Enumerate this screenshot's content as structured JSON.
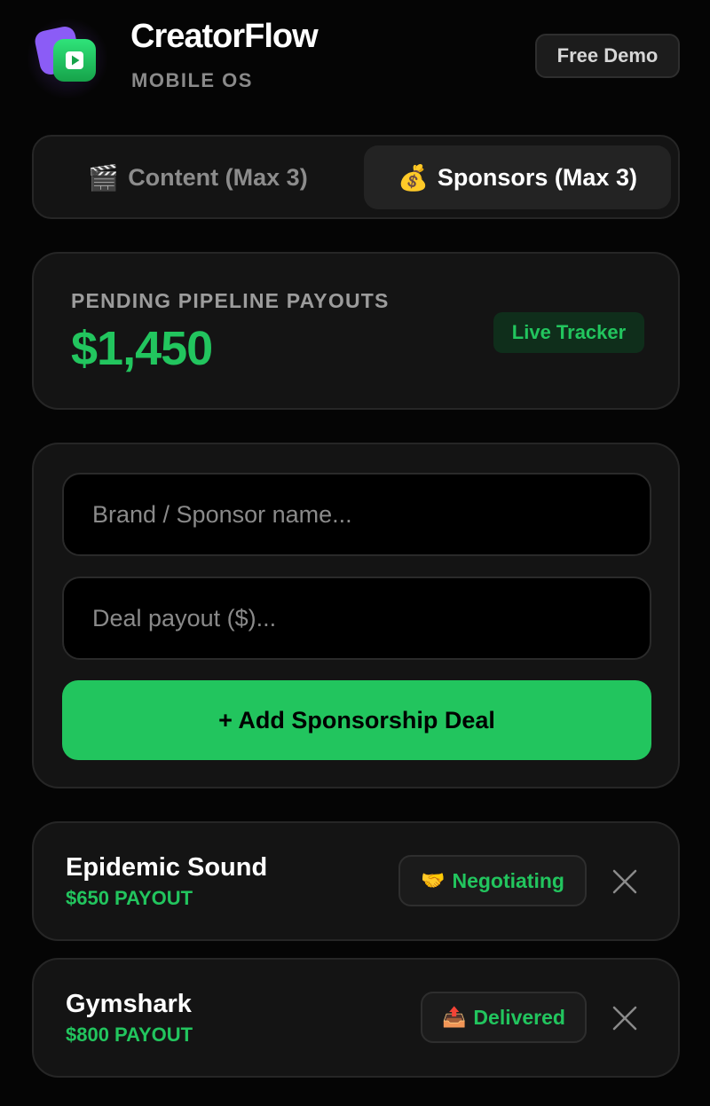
{
  "app": {
    "title": "CreatorFlow",
    "subtitle": "MOBILE OS",
    "demo_button": "Free Demo",
    "logo_icon": "play-icon"
  },
  "tabs": [
    {
      "icon": "🎬",
      "label": "Content (Max 3)",
      "active": false
    },
    {
      "icon": "💰",
      "label": "Sponsors (Max 3)",
      "active": true
    }
  ],
  "payouts": {
    "label": "PENDING PIPELINE PAYOUTS",
    "value": "$1,450",
    "badge": "Live Tracker"
  },
  "form": {
    "brand_placeholder": "Brand / Sponsor name...",
    "payout_placeholder": "Deal payout ($)...",
    "submit_label": "+ Add Sponsorship Deal"
  },
  "deals": [
    {
      "name": "Epidemic Sound",
      "payout": "$650 PAYOUT",
      "status_icon": "🤝",
      "status": "Negotiating"
    },
    {
      "name": "Gymshark",
      "payout": "$800 PAYOUT",
      "status_icon": "📤",
      "status": "Delivered"
    }
  ],
  "colors": {
    "accent": "#22c55e",
    "background": "#050505",
    "card": "#141414",
    "logo_purple": "#8b5cf6"
  }
}
